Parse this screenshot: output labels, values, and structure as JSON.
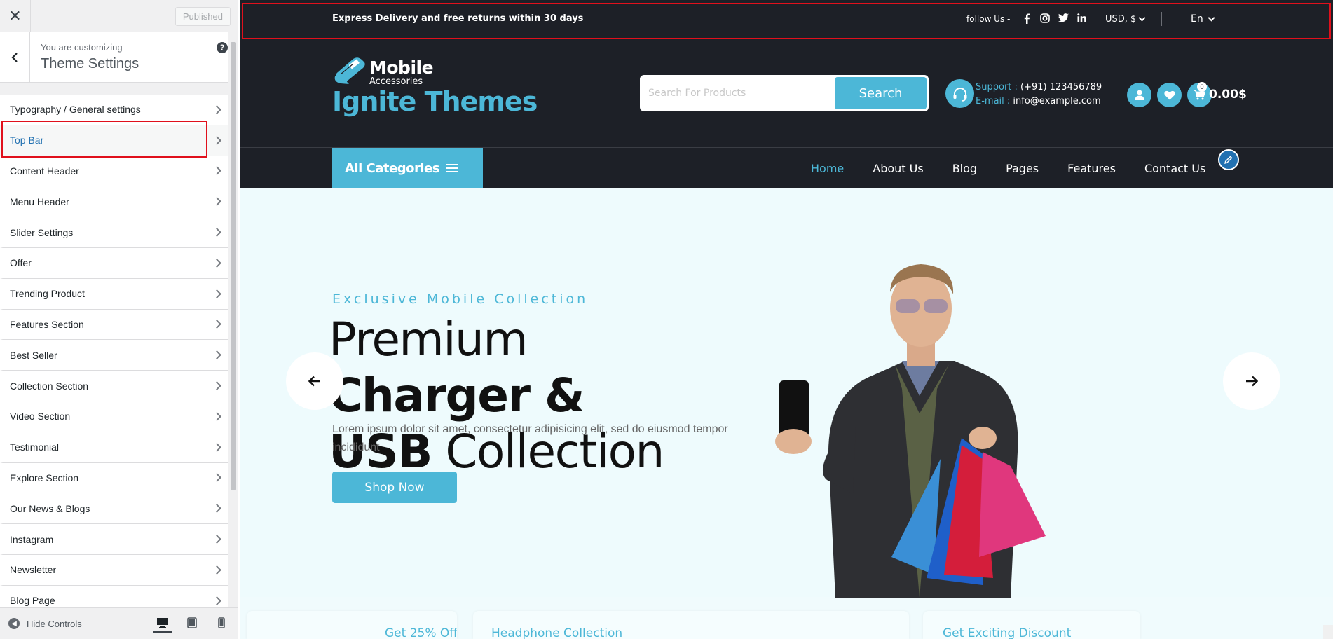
{
  "customizer": {
    "close_icon": "close-icon",
    "published_label": "Published",
    "customizing_label": "You are customizing",
    "panel_title": "Theme Settings",
    "help_label": "?",
    "sections": [
      {
        "label": "Typography / General settings"
      },
      {
        "label": "Top Bar",
        "active": true
      },
      {
        "label": "Content Header"
      },
      {
        "label": "Menu Header"
      },
      {
        "label": "Slider Settings"
      },
      {
        "label": "Offer"
      },
      {
        "label": "Trending Product"
      },
      {
        "label": "Features Section"
      },
      {
        "label": "Best Seller"
      },
      {
        "label": "Collection Section"
      },
      {
        "label": "Video Section"
      },
      {
        "label": "Testimonial"
      },
      {
        "label": "Explore Section"
      },
      {
        "label": "Our News & Blogs"
      },
      {
        "label": "Instagram"
      },
      {
        "label": "Newsletter"
      },
      {
        "label": "Blog Page"
      }
    ],
    "hide_controls_label": "Hide Controls",
    "devices": [
      "desktop-icon",
      "tablet-icon",
      "mobile-icon"
    ]
  },
  "topbar": {
    "text": "Express Delivery and free returns within 30 days",
    "follow_label": "follow Us -",
    "socials": [
      "facebook-icon",
      "instagram-icon",
      "twitter-icon",
      "linkedin-icon"
    ],
    "currency": "USD, $",
    "language": "En"
  },
  "header": {
    "logo_line1": "Mobile",
    "logo_line2": "Accessories",
    "brand": "Ignite Themes",
    "search_placeholder": "Search For Products",
    "search_button": "Search",
    "support_label": "Support :",
    "support_phone": "(+91) 123456789",
    "email_label": "E-mail :",
    "email": "info@example.com",
    "cart_count": "0",
    "cart_total": "0.00$"
  },
  "nav": {
    "all_categories": "All Categories",
    "items": [
      "Home",
      "About Us",
      "Blog",
      "Pages",
      "Features",
      "Contact Us"
    ]
  },
  "hero": {
    "subtitle": "Exclusive Mobile Collection",
    "title_part1": "Premium ",
    "title_bold1": "Charger &",
    "title_bold2": "USB",
    "title_part2": " Collection",
    "description": "Lorem ipsum dolor sit amet, consectetur adipisicing elit, sed do eiusmod tempor incididunt",
    "button": "Shop Now"
  },
  "cards": [
    "Get 25% Off",
    "Headphone Collection",
    "Get Exciting Discount"
  ],
  "colors": {
    "accent": "#4cb7d7",
    "dark": "#1d2027",
    "highlight": "#e0101c",
    "wp_blue": "#2271b1"
  }
}
